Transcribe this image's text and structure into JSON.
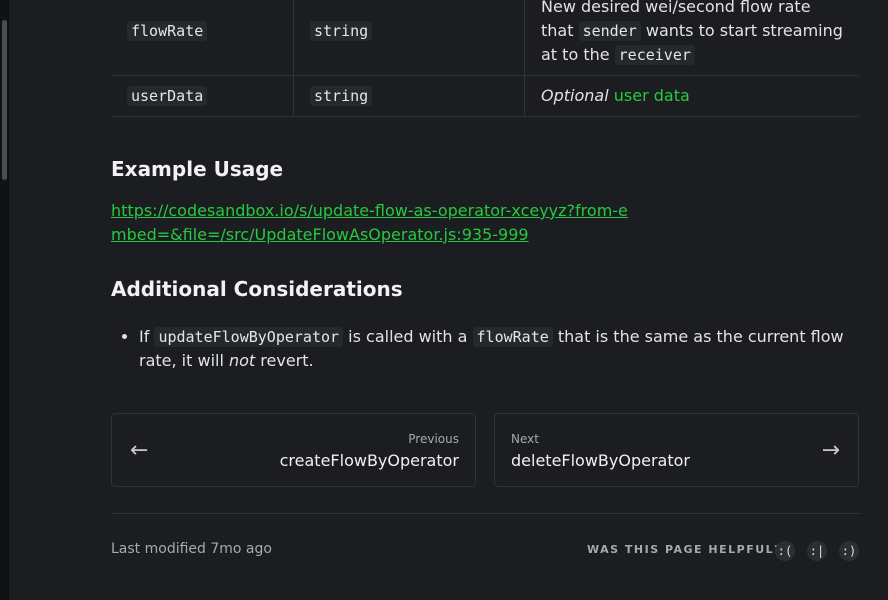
{
  "params": [
    {
      "name": "flowRate",
      "type": "string",
      "desc_parts": [
        "New desired wei/second flow rate that ",
        "sender",
        " wants to start streaming at to the ",
        "receiver"
      ]
    },
    {
      "name": "userData",
      "type": "string",
      "desc_optional": "Optional",
      "desc_link": "user data"
    }
  ],
  "example": {
    "heading": "Example Usage",
    "url": "https://codesandbox.io/s/update-flow-as-operator-xceyyz?from-embed=&file=/src/UpdateFlowAsOperator.js:935-999"
  },
  "considerations": {
    "heading": "Additional Considerations",
    "item_parts": [
      "If ",
      "updateFlowByOperator",
      " is called with a ",
      "flowRate",
      " that is the same as the current flow rate, it will ",
      "not",
      " revert."
    ]
  },
  "nav": {
    "previous_label": "Previous",
    "previous_title": "createFlowByOperator",
    "next_label": "Next",
    "next_title": "deleteFlowByOperator",
    "arrow_left": "←",
    "arrow_right": "→"
  },
  "footer": {
    "last_modified": "Last modified 7mo ago",
    "helpful_label": "WAS THIS PAGE HELPFUL?",
    "faces": [
      "sad-face-icon",
      "neutral-face-icon",
      "happy-face-icon"
    ]
  },
  "colors": {
    "link": "#28c840",
    "background": "#1b1d21"
  }
}
